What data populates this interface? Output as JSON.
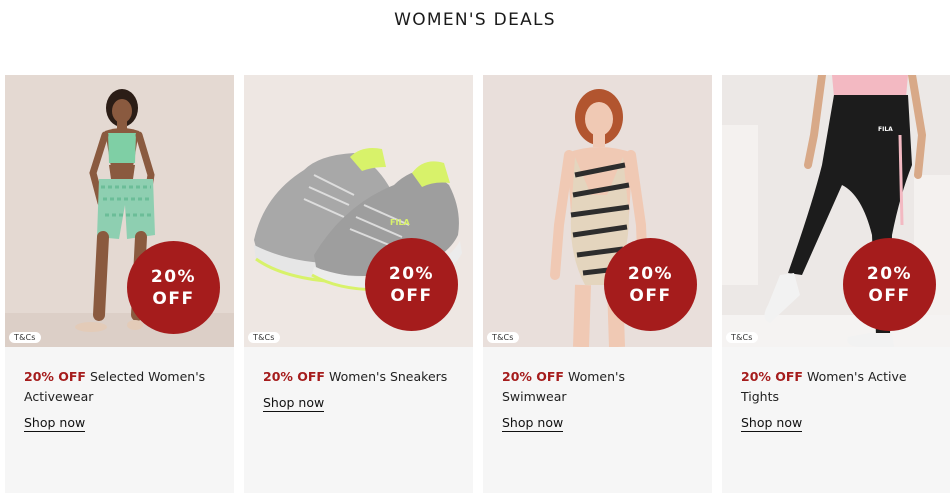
{
  "page": {
    "title": "WOMEN'S DEALS"
  },
  "cards": [
    {
      "badge_line1": "20%",
      "badge_line2": "OFF",
      "tcs": "T&Cs",
      "offer": "20% OFF",
      "desc": "Selected Women's Activewear",
      "cta": "Shop now"
    },
    {
      "badge_line1": "20%",
      "badge_line2": "OFF",
      "tcs": "T&Cs",
      "offer": "20% OFF",
      "desc": "Women's Sneakers",
      "cta": "Shop now"
    },
    {
      "badge_line1": "20%",
      "badge_line2": "OFF",
      "tcs": "T&Cs",
      "offer": "20% OFF",
      "desc": "Women's Swimwear",
      "cta": "Shop now"
    },
    {
      "badge_line1": "20%",
      "badge_line2": "OFF",
      "tcs": "T&Cs",
      "offer": "20% OFF",
      "desc": "Women's Active Tights",
      "cta": "Shop now"
    }
  ],
  "colors": {
    "accent": "#a51c1c",
    "card_bg": "#f6f6f6"
  }
}
